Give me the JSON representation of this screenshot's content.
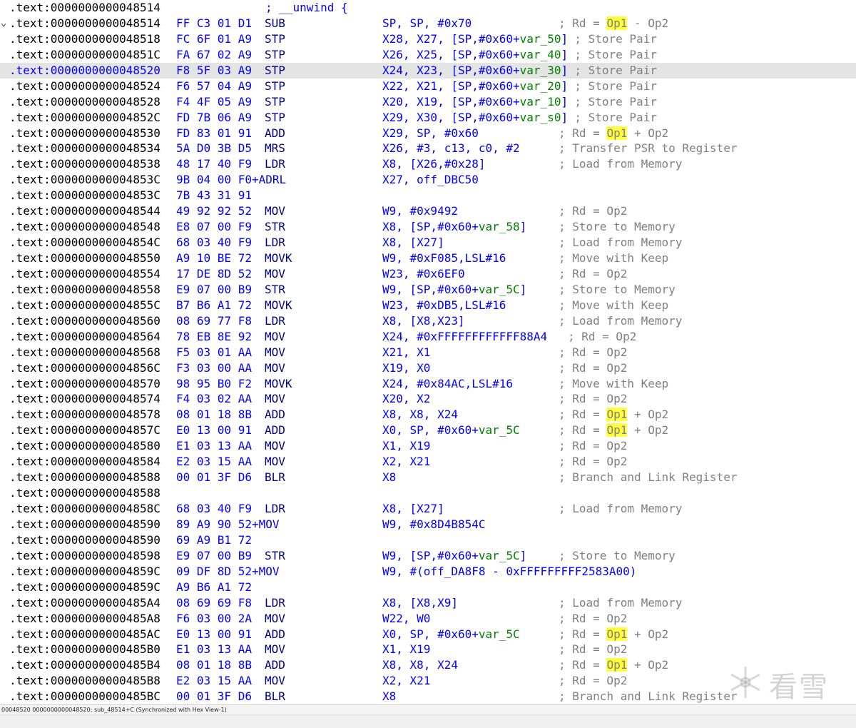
{
  "listing": [
    {
      "addr": ".text:0000000000048514",
      "bytes": "",
      "mn": "",
      "ops": "",
      "cmt": "; __unwind {",
      "cmt_col": 372,
      "cmt_color": "#0000ff"
    },
    {
      "addr": ".text:0000000000048514",
      "bytes": "FF C3 01 D1",
      "mn": "SUB",
      "ops": "SP, SP, #0x70",
      "cmt": "; Rd = Op1 - Op2",
      "arrow": "chevron"
    },
    {
      "addr": ".text:0000000000048518",
      "bytes": "FC 6F 01 A9",
      "mn": "STP",
      "ops": "X28, X27, [SP,#0x60+var_50]",
      "cmt": "; Store Pair"
    },
    {
      "addr": ".text:000000000004851C",
      "bytes": "FA 67 02 A9",
      "mn": "STP",
      "ops": "X26, X25, [SP,#0x60+var_40]",
      "cmt": "; Store Pair"
    },
    {
      "addr": ".text:0000000000048520",
      "bytes": "F8 5F 03 A9",
      "mn": "STP",
      "ops": "X24, X23, [SP,#0x60+var_30]",
      "cmt": "; Store Pair",
      "selected": true
    },
    {
      "addr": ".text:0000000000048524",
      "bytes": "F6 57 04 A9",
      "mn": "STP",
      "ops": "X22, X21, [SP,#0x60+var_20]",
      "cmt": "; Store Pair"
    },
    {
      "addr": ".text:0000000000048528",
      "bytes": "F4 4F 05 A9",
      "mn": "STP",
      "ops": "X20, X19, [SP,#0x60+var_10]",
      "cmt": "; Store Pair"
    },
    {
      "addr": ".text:000000000004852C",
      "bytes": "FD 7B 06 A9",
      "mn": "STP",
      "ops": "X29, X30, [SP,#0x60+var_s0]",
      "cmt": "; Store Pair"
    },
    {
      "addr": ".text:0000000000048530",
      "bytes": "FD 83 01 91",
      "mn": "ADD",
      "ops": "X29, SP, #0x60",
      "cmt": "; Rd = Op1 + Op2"
    },
    {
      "addr": ".text:0000000000048534",
      "bytes": "5A D0 3B D5",
      "mn": "MRS",
      "ops": "X26, #3, c13, c0, #2",
      "cmt": "; Transfer PSR to Register"
    },
    {
      "addr": ".text:0000000000048538",
      "bytes": "48 17 40 F9",
      "mn": "LDR",
      "ops": "X8, [X26,#0x28]",
      "cmt": "; Load from Memory"
    },
    {
      "addr": ".text:000000000004853C",
      "bytes": "9B 04 00 F0+ADRL",
      "mn": "",
      "ops": "X27, off_DBC50",
      "cmt": ""
    },
    {
      "addr": ".text:000000000004853C",
      "bytes": "7B 43 31 91",
      "mn": "",
      "ops": "",
      "cmt": ""
    },
    {
      "addr": ".text:0000000000048544",
      "bytes": "49 92 92 52",
      "mn": "MOV",
      "ops": "W9, #0x9492",
      "cmt": "; Rd = Op2"
    },
    {
      "addr": ".text:0000000000048548",
      "bytes": "E8 07 00 F9",
      "mn": "STR",
      "ops": "X8, [SP,#0x60+var_58]",
      "cmt": "; Store to Memory"
    },
    {
      "addr": ".text:000000000004854C",
      "bytes": "68 03 40 F9",
      "mn": "LDR",
      "ops": "X8, [X27]",
      "cmt": "; Load from Memory"
    },
    {
      "addr": ".text:0000000000048550",
      "bytes": "A9 10 BE 72",
      "mn": "MOVK",
      "ops": "W9, #0xF085,LSL#16",
      "cmt": "; Move with Keep"
    },
    {
      "addr": ".text:0000000000048554",
      "bytes": "17 DE 8D 52",
      "mn": "MOV",
      "ops": "W23, #0x6EF0",
      "cmt": "; Rd = Op2"
    },
    {
      "addr": ".text:0000000000048558",
      "bytes": "E9 07 00 B9",
      "mn": "STR",
      "ops": "W9, [SP,#0x60+var_5C]",
      "cmt": "; Store to Memory"
    },
    {
      "addr": ".text:000000000004855C",
      "bytes": "B7 B6 A1 72",
      "mn": "MOVK",
      "ops": "W23, #0xDB5,LSL#16",
      "cmt": "; Move with Keep"
    },
    {
      "addr": ".text:0000000000048560",
      "bytes": "08 69 77 F8",
      "mn": "LDR",
      "ops": "X8, [X8,X23]",
      "cmt": "; Load from Memory"
    },
    {
      "addr": ".text:0000000000048564",
      "bytes": "78 EB 8E 92",
      "mn": "MOV",
      "ops": "X24, #0xFFFFFFFFFFFF88A4",
      "cmt": "; Rd = Op2",
      "cmt_col": 796
    },
    {
      "addr": ".text:0000000000048568",
      "bytes": "F5 03 01 AA",
      "mn": "MOV",
      "ops": "X21, X1",
      "cmt": "; Rd = Op2"
    },
    {
      "addr": ".text:000000000004856C",
      "bytes": "F3 03 00 AA",
      "mn": "MOV",
      "ops": "X19, X0",
      "cmt": "; Rd = Op2"
    },
    {
      "addr": ".text:0000000000048570",
      "bytes": "98 95 B0 F2",
      "mn": "MOVK",
      "ops": "X24, #0x84AC,LSL#16",
      "cmt": "; Move with Keep"
    },
    {
      "addr": ".text:0000000000048574",
      "bytes": "F4 03 02 AA",
      "mn": "MOV",
      "ops": "X20, X2",
      "cmt": "; Rd = Op2"
    },
    {
      "addr": ".text:0000000000048578",
      "bytes": "08 01 18 8B",
      "mn": "ADD",
      "ops": "X8, X8, X24",
      "cmt": "; Rd = Op1 + Op2"
    },
    {
      "addr": ".text:000000000004857C",
      "bytes": "E0 13 00 91",
      "mn": "ADD",
      "ops": "X0, SP, #0x60+var_5C",
      "cmt": "; Rd = Op1 + Op2"
    },
    {
      "addr": ".text:0000000000048580",
      "bytes": "E1 03 13 AA",
      "mn": "MOV",
      "ops": "X1, X19",
      "cmt": "; Rd = Op2"
    },
    {
      "addr": ".text:0000000000048584",
      "bytes": "E2 03 15 AA",
      "mn": "MOV",
      "ops": "X2, X21",
      "cmt": "; Rd = Op2"
    },
    {
      "addr": ".text:0000000000048588",
      "bytes": "00 01 3F D6",
      "mn": "BLR",
      "ops": "X8",
      "cmt": "; Branch and Link Register"
    },
    {
      "addr": ".text:0000000000048588",
      "bytes": "",
      "mn": "",
      "ops": "",
      "cmt": ""
    },
    {
      "addr": ".text:000000000004858C",
      "bytes": "68 03 40 F9",
      "mn": "LDR",
      "ops": "X8, [X27]",
      "cmt": "; Load from Memory"
    },
    {
      "addr": ".text:0000000000048590",
      "bytes": "89 A9 90 52+MOV",
      "mn": "",
      "ops": "W9, #0x8D4B854C",
      "cmt": ""
    },
    {
      "addr": ".text:0000000000048590",
      "bytes": "69 A9 B1 72",
      "mn": "",
      "ops": "",
      "cmt": ""
    },
    {
      "addr": ".text:0000000000048598",
      "bytes": "E9 07 00 B9",
      "mn": "STR",
      "ops": "W9, [SP,#0x60+var_5C]",
      "cmt": "; Store to Memory"
    },
    {
      "addr": ".text:000000000004859C",
      "bytes": "09 DF 8D 52+MOV",
      "mn": "",
      "ops": "W9, #(off_DA8F8 - 0xFFFFFFFFF2583A00)",
      "cmt": ""
    },
    {
      "addr": ".text:000000000004859C",
      "bytes": "A9 B6 A1 72",
      "mn": "",
      "ops": "",
      "cmt": ""
    },
    {
      "addr": ".text:00000000000485A4",
      "bytes": "08 69 69 F8",
      "mn": "LDR",
      "ops": "X8, [X8,X9]",
      "cmt": "; Load from Memory"
    },
    {
      "addr": ".text:00000000000485A8",
      "bytes": "F6 03 00 2A",
      "mn": "MOV",
      "ops": "W22, W0",
      "cmt": "; Rd = Op2"
    },
    {
      "addr": ".text:00000000000485AC",
      "bytes": "E0 13 00 91",
      "mn": "ADD",
      "ops": "X0, SP, #0x60+var_5C",
      "cmt": "; Rd = Op1 + Op2"
    },
    {
      "addr": ".text:00000000000485B0",
      "bytes": "E1 03 13 AA",
      "mn": "MOV",
      "ops": "X1, X19",
      "cmt": "; Rd = Op2"
    },
    {
      "addr": ".text:00000000000485B4",
      "bytes": "08 01 18 8B",
      "mn": "ADD",
      "ops": "X8, X8, X24",
      "cmt": "; Rd = Op1 + Op2"
    },
    {
      "addr": ".text:00000000000485B8",
      "bytes": "E2 03 15 AA",
      "mn": "MOV",
      "ops": "X2, X21",
      "cmt": "; Rd = Op2"
    },
    {
      "addr": ".text:00000000000485BC",
      "bytes": "00 01 3F D6",
      "mn": "BLR",
      "ops": "X8",
      "cmt": "; Branch and Link Register"
    }
  ],
  "status_bar": {
    "text": "00048520 0000000000048520: sub_48514+C (Synchronized with Hex View-1)"
  },
  "watermark": {
    "text": "看雪",
    "icon": "snowflake-icon"
  },
  "colors": {
    "address": "#000000",
    "address_selected": "#0000ff",
    "bytes": "#0000ff",
    "mnemonic": "#000080",
    "operand": "#0000ff",
    "variable": "#008000",
    "comment": "#808080",
    "op1_highlight": "#ffff3c",
    "selected_row": "#e4e4e4"
  }
}
